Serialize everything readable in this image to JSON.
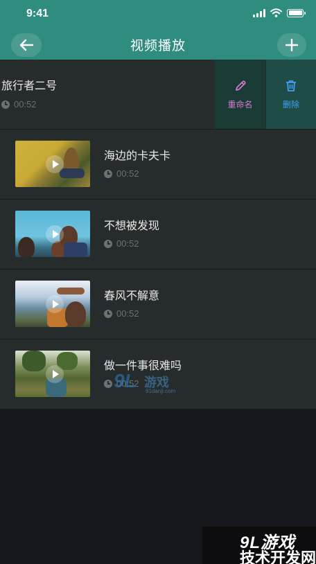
{
  "status_bar": {
    "time": "9:41"
  },
  "header": {
    "title": "视频播放"
  },
  "first_item": {
    "title": "旅行者二号",
    "duration": "00:52"
  },
  "actions": {
    "rename": "重命名",
    "delete": "删除"
  },
  "videos": [
    {
      "title": "海边的卡夫卡",
      "duration": "00:52"
    },
    {
      "title": "不想被发现",
      "duration": "00:52"
    },
    {
      "title": "春风不解意",
      "duration": "00:52"
    },
    {
      "title": "做一件事很难吗",
      "duration": "00:52"
    }
  ],
  "watermarks": {
    "small_logo": "9L",
    "small_cn": "游戏",
    "small_url": "91danji.com",
    "big_top": "9L游戏",
    "big_bottom": "技术开发网"
  },
  "colors": {
    "header": "#2f8d80",
    "rename": "#d77ad0",
    "delete": "#3ea1f6"
  }
}
